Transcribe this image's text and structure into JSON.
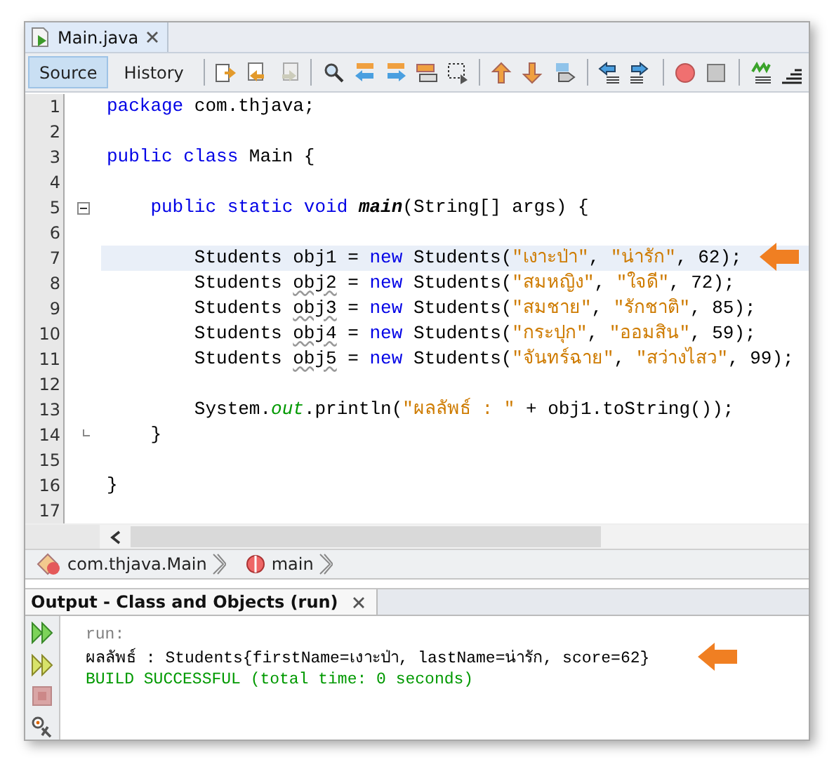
{
  "editor_tab": {
    "title": "Main.java",
    "selected": true
  },
  "view_tabs": [
    {
      "label": "Source",
      "selected": true
    },
    {
      "label": "History",
      "selected": false
    }
  ],
  "code_lines": [
    {
      "number": "1",
      "current": false,
      "tokens": [
        {
          "kind": "keyword",
          "text": "package"
        },
        {
          "kind": "plain",
          "text": " com.thjava;"
        }
      ]
    },
    {
      "number": "2",
      "current": false
    },
    {
      "number": "3",
      "current": false,
      "tokens": [
        {
          "kind": "keyword",
          "text": "public class"
        },
        {
          "kind": "plain",
          "text": " Main {"
        }
      ]
    },
    {
      "number": "4",
      "current": false
    },
    {
      "number": "5",
      "current": false,
      "kind": "fold_start",
      "tokens": [
        {
          "kind": "keyword",
          "text": "    public static void "
        },
        {
          "kind": "method",
          "text": "main"
        },
        {
          "kind": "plain",
          "text": "(String[] args) {"
        }
      ]
    },
    {
      "number": "6",
      "current": false
    },
    {
      "number": "7",
      "current": true,
      "arrow": true,
      "tokens": [
        {
          "kind": "plain",
          "text": "        Students obj1 = "
        },
        {
          "kind": "keyword",
          "text": "new"
        },
        {
          "kind": "plain",
          "text": " Students("
        },
        {
          "kind": "string",
          "text": "\"เงาะป่า\""
        },
        {
          "kind": "plain",
          "text": ", "
        },
        {
          "kind": "string",
          "text": "\"น่ารัก\""
        },
        {
          "kind": "plain",
          "text": ", 62);"
        }
      ]
    },
    {
      "number": "8",
      "current": false,
      "tokens": [
        {
          "kind": "plain",
          "text": "        Students "
        },
        {
          "kind": "warning",
          "text": "obj2"
        },
        {
          "kind": "plain",
          "text": " = "
        },
        {
          "kind": "keyword",
          "text": "new"
        },
        {
          "kind": "plain",
          "text": " Students("
        },
        {
          "kind": "string",
          "text": "\"สมหญิง\""
        },
        {
          "kind": "plain",
          "text": ", "
        },
        {
          "kind": "string",
          "text": "\"ใจดี\""
        },
        {
          "kind": "plain",
          "text": ", 72);"
        }
      ]
    },
    {
      "number": "9",
      "current": false,
      "tokens": [
        {
          "kind": "plain",
          "text": "        Students "
        },
        {
          "kind": "warning",
          "text": "obj3"
        },
        {
          "kind": "plain",
          "text": " = "
        },
        {
          "kind": "keyword",
          "text": "new"
        },
        {
          "kind": "plain",
          "text": " Students("
        },
        {
          "kind": "string",
          "text": "\"สมชาย\""
        },
        {
          "kind": "plain",
          "text": ", "
        },
        {
          "kind": "string",
          "text": "\"รักชาติ\""
        },
        {
          "kind": "plain",
          "text": ", 85);"
        }
      ]
    },
    {
      "number": "10",
      "current": false,
      "tokens": [
        {
          "kind": "plain",
          "text": "        Students "
        },
        {
          "kind": "warning",
          "text": "obj4"
        },
        {
          "kind": "plain",
          "text": " = "
        },
        {
          "kind": "keyword",
          "text": "new"
        },
        {
          "kind": "plain",
          "text": " Students("
        },
        {
          "kind": "string",
          "text": "\"กระปุก\""
        },
        {
          "kind": "plain",
          "text": ", "
        },
        {
          "kind": "string",
          "text": "\"ออมสิน\""
        },
        {
          "kind": "plain",
          "text": ", 59);"
        }
      ]
    },
    {
      "number": "11",
      "current": false,
      "tokens": [
        {
          "kind": "plain",
          "text": "        Students "
        },
        {
          "kind": "warning",
          "text": "obj5"
        },
        {
          "kind": "plain",
          "text": " = "
        },
        {
          "kind": "keyword",
          "text": "new"
        },
        {
          "kind": "plain",
          "text": " Students("
        },
        {
          "kind": "string",
          "text": "\"จันทร์ฉาย\""
        },
        {
          "kind": "plain",
          "text": ", "
        },
        {
          "kind": "string",
          "text": "\"สว่างไสว\""
        },
        {
          "kind": "plain",
          "text": ", 99);"
        }
      ]
    },
    {
      "number": "12",
      "current": false
    },
    {
      "number": "13",
      "current": false,
      "tokens": [
        {
          "kind": "plain",
          "text": "        System."
        },
        {
          "kind": "field",
          "text": "out"
        },
        {
          "kind": "plain",
          "text": ".println("
        },
        {
          "kind": "string",
          "text": "\"ผลลัพธ์ : \""
        },
        {
          "kind": "plain",
          "text": " + obj1.toString());"
        }
      ]
    },
    {
      "number": "14",
      "current": false,
      "kind": "fold_end",
      "tokens": [
        {
          "kind": "plain",
          "text": "    }"
        }
      ]
    },
    {
      "number": "15",
      "current": false
    },
    {
      "number": "16",
      "current": false,
      "tokens": [
        {
          "kind": "plain",
          "text": "}"
        }
      ]
    },
    {
      "number": "17",
      "current": false
    }
  ],
  "breadcrumbs": [
    {
      "kind": "class",
      "label": "com.thjava.Main"
    },
    {
      "kind": "method",
      "label": "main"
    }
  ],
  "output": {
    "title": "Output - Class and Objects (run)",
    "lines": [
      {
        "kind": "muted",
        "text": "run:"
      },
      {
        "kind": "plain",
        "text": "ผลลัพธ์ : Students{firstName=เงาะป่า, lastName=น่ารัก, score=62}",
        "arrow": true
      },
      {
        "kind": "success",
        "text": "BUILD SUCCESSFUL (total time: 0 seconds)"
      }
    ]
  }
}
